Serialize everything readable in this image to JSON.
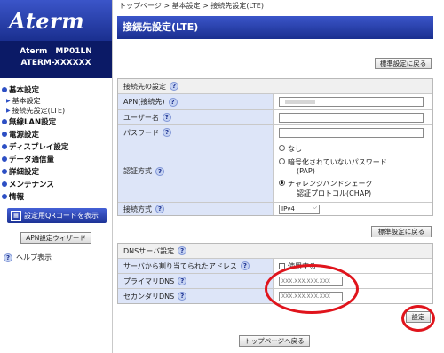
{
  "app": {
    "logo": "Aterm",
    "model_line1": "Aterm　MP01LN",
    "model_line2": "ATERM-XXXXXX"
  },
  "sidebar": {
    "items": [
      {
        "label": "基本設定",
        "subs": [
          "基本設定",
          "接続先設定(LTE)"
        ]
      },
      {
        "label": "無線LAN設定"
      },
      {
        "label": "電源設定"
      },
      {
        "label": "ディスプレイ設定"
      },
      {
        "label": "データ通信量"
      },
      {
        "label": "詳細設定"
      },
      {
        "label": "メンテナンス"
      },
      {
        "label": "情報"
      }
    ],
    "qr_button": "設定用QRコードを表示",
    "wizard_button": "APN設定ウィザード",
    "help": "ヘルプ表示"
  },
  "breadcrumb": "トップページ > 基本設定 > 接続先設定(LTE)",
  "page_title": "接続先設定(LTE)",
  "default_button": "標準設定に戻る",
  "connection": {
    "header": "接続先の設定",
    "apn_label": "APN(接続先)",
    "apn_value": "",
    "user_label": "ユーザー名",
    "password_label": "パスワード",
    "auth_label": "認証方式",
    "auth_options": [
      "なし",
      "暗号化されていないパスワード",
      "(PAP)",
      "チャレンジハンドシェーク",
      "認証プロトコル(CHAP)"
    ],
    "method_label": "接続方式",
    "method_value": "IPv4"
  },
  "dns": {
    "header": "DNSサーバ設定",
    "auto_label": "サーバから割り当てられたアドレス",
    "auto_check": "使用する",
    "primary_label": "プライマリDNS",
    "primary_value": "XXX.XXX.XXX.XXX",
    "secondary_label": "セカンダリDNS",
    "secondary_value": "XXX.XXX.XXX.XXX"
  },
  "set_button": "設定",
  "top_page_button": "トップページへ戻る",
  "help_mark": "?",
  "colors": {
    "accent": "#1a2f8f",
    "highlight": "#e0141c",
    "label_bg": "#dde5f8"
  }
}
